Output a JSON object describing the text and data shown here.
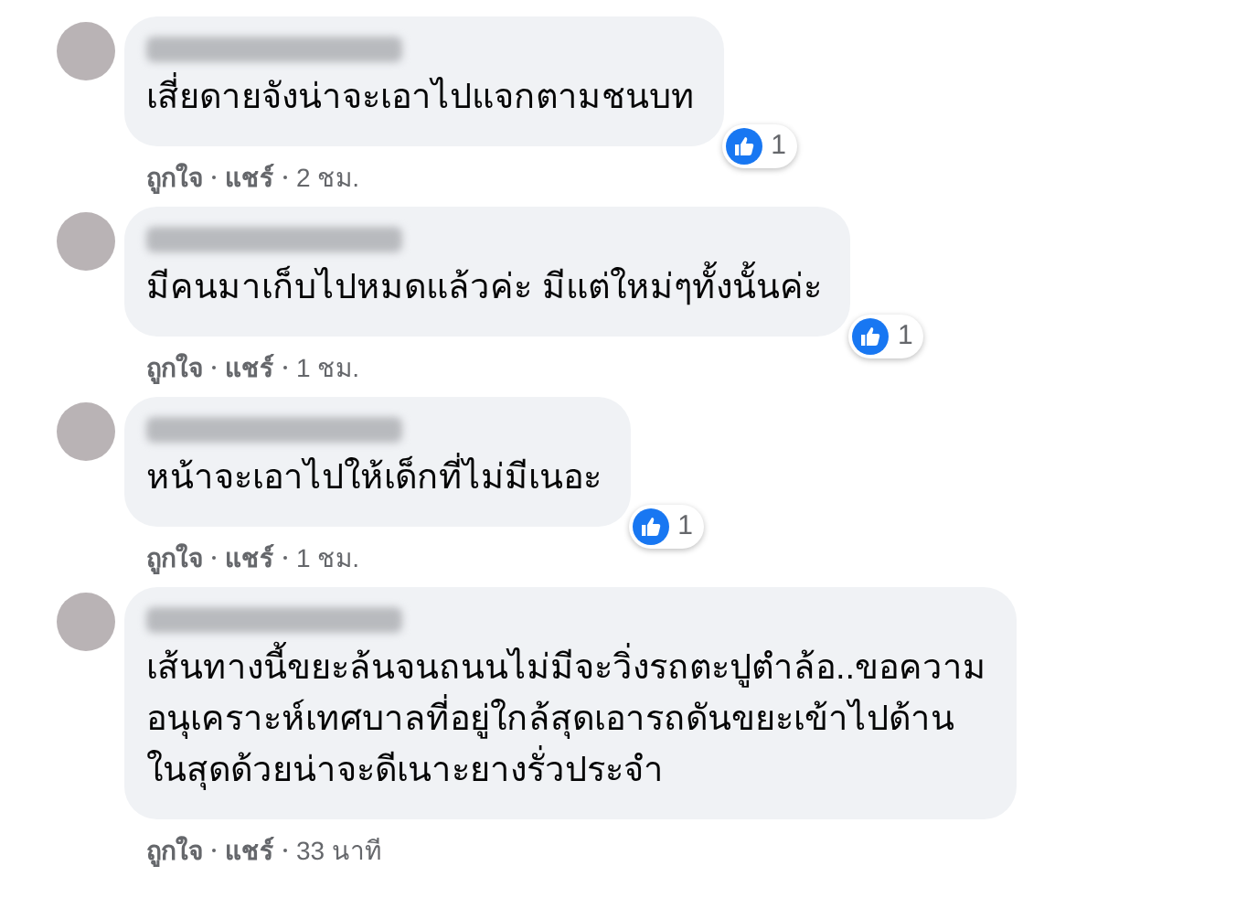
{
  "comments": [
    {
      "text": "เสี่ยดายจังน่าจะเอาไปแจกตามชนบท",
      "reaction": {
        "count": "1"
      },
      "actions": {
        "like": "ถูกใจ",
        "share": "แชร์",
        "time": "2 ชม."
      }
    },
    {
      "text": "มีคนมาเก็บไปหมดแล้วค่ะ มีแต่ใหม่ๆทั้งนั้นค่ะ",
      "reaction": {
        "count": "1"
      },
      "actions": {
        "like": "ถูกใจ",
        "share": "แชร์",
        "time": "1 ชม."
      }
    },
    {
      "text": "หน้าจะเอาไปให้เด็กที่ไม่มีเนอะ",
      "reaction": {
        "count": "1"
      },
      "actions": {
        "like": "ถูกใจ",
        "share": "แชร์",
        "time": "1 ชม."
      }
    },
    {
      "text": "เส้นทางนี้ขยะล้นจนถนนไม่มีจะวิ่งรถตะปูตำล้อ..ขอความ\nอนุเคราะห์เทศบาลที่อยู่ใกล้สุดเอารถดันขยะเข้าไปด้าน\nในสุดด้วยน่าจะดีเนาะยางรั่วประจำ",
      "actions": {
        "like": "ถูกใจ",
        "share": "แชร์",
        "time": "33 นาที"
      }
    }
  ]
}
